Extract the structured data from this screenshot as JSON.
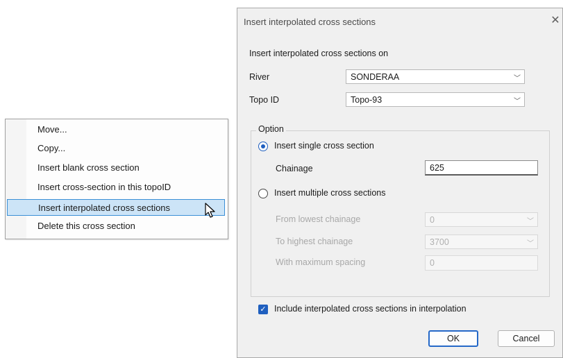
{
  "context_menu": {
    "items": [
      {
        "label": "Move..."
      },
      {
        "label": "Copy..."
      },
      {
        "label": "Insert blank cross section"
      },
      {
        "label": "Insert cross-section in this topoID"
      },
      {
        "label": "Insert interpolated cross sections"
      },
      {
        "label": "Delete this cross section"
      }
    ],
    "highlighted_index": 4
  },
  "dialog": {
    "title": "Insert interpolated cross sections",
    "intro": "Insert interpolated cross sections on",
    "river": {
      "label": "River",
      "value": "SONDERAA"
    },
    "topo": {
      "label": "Topo ID",
      "value": "Topo-93"
    },
    "option_group": {
      "label": "Option",
      "single": {
        "label": "Insert single cross section",
        "selected": true
      },
      "chainage": {
        "label": "Chainage",
        "value": "625"
      },
      "multiple": {
        "label": "Insert multiple cross sections",
        "selected": false
      },
      "from_lowest": {
        "label": "From lowest chainage",
        "value": "0"
      },
      "to_highest": {
        "label": "To highest chainage",
        "value": "3700"
      },
      "max_spacing": {
        "label": "With maximum spacing",
        "value": "0"
      }
    },
    "include_checkbox": {
      "label": "Include interpolated cross sections in interpolation",
      "checked": true
    },
    "ok_label": "OK",
    "cancel_label": "Cancel"
  },
  "colors": {
    "accent": "#1f5fbf",
    "highlight": "#cce4f7"
  }
}
